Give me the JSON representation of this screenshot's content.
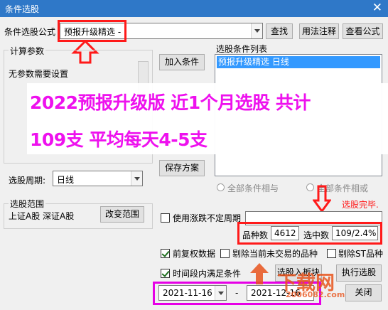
{
  "window": {
    "title": "条件选股",
    "close": "✕"
  },
  "formula": {
    "label": "条件选股公式",
    "value": "预报升级精选 -"
  },
  "buttons": {
    "find": "查找",
    "usage": "用法注释",
    "view_formula": "查看公式",
    "add_condition": "加入条件",
    "save_plan": "保存方案",
    "change_range": "改变范围",
    "select_to_block": "选股入板块",
    "run_select": "执行选股",
    "close": "关闭"
  },
  "params": {
    "group_title": "计算参数",
    "none_text": "无参数需要设置"
  },
  "period": {
    "label": "选股周期:",
    "value": "日线"
  },
  "conditions": {
    "group_title": "选股条件列表",
    "items": [
      "预报升级精选  日线"
    ]
  },
  "logic": {
    "and_label": "全部条件相与",
    "or_label": "全部条件相或"
  },
  "status": {
    "done": "选股完毕."
  },
  "range": {
    "group_title": "选股范围",
    "value": "上证A股 深证A股"
  },
  "options": {
    "use_limit_period": "使用涨跌不定周期",
    "forward_adjust": "前复权数据",
    "exclude_untraded": "剔除当前未交易的品种",
    "exclude_st": "剔除ST品种",
    "time_period": "时间段内满足条件"
  },
  "stats": {
    "count_label": "品种数",
    "count_value": "4612",
    "selected_label": "选中数",
    "selected_value": "109/2.4%"
  },
  "dates": {
    "start": "2021-11-16",
    "sep": "-",
    "end": "2021-12-16"
  },
  "overlay": {
    "line1": "2022预报升级版  近1个月选股 共计",
    "line2": "109支 平均每天4-5支"
  },
  "watermark": {
    "brand": "下载网",
    "url": "2006082.com"
  }
}
